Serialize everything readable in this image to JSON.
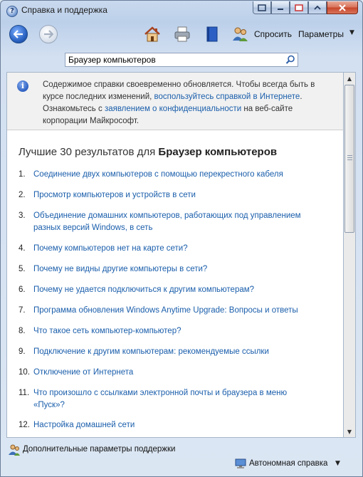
{
  "window": {
    "title": "Справка и поддержка",
    "accent": "#1a5eab"
  },
  "toolbar": {
    "back_icon": "back-arrow-icon",
    "forward_icon": "forward-arrow-icon",
    "home_icon": "home-icon",
    "print_icon": "printer-icon",
    "browse_icon": "book-icon",
    "ask_icon": "people-icon",
    "ask_label": "Спросить",
    "options_label": "Параметры"
  },
  "search": {
    "value": "Браузер компьютеров"
  },
  "info": {
    "text_1": "Содержимое справки своевременно обновляется. Чтобы всегда быть в курсе последних изменений, ",
    "link_1": "воспользуйтесь справкой в Интернете",
    "text_2": ". Ознакомьтесь с ",
    "link_2": "заявлением о конфиденциальности",
    "text_3": " на веб-сайте корпорации Майкрософт."
  },
  "results": {
    "heading_prefix": "Лучшие 30 результатов для ",
    "heading_query": "Браузер компьютеров",
    "items": [
      {
        "num": "1.",
        "label": "Соединение двух компьютеров с помощью перекрестного кабеля"
      },
      {
        "num": "2.",
        "label": "Просмотр компьютеров и устройств в сети"
      },
      {
        "num": "3.",
        "label": "Объединение домашних компьютеров, работающих под управлением разных версий Windows, в сеть"
      },
      {
        "num": "4.",
        "label": "Почему компьютеров нет на карте сети?"
      },
      {
        "num": "5.",
        "label": "Почему не видны другие компьютеры в сети?"
      },
      {
        "num": "6.",
        "label": "Почему не удается подключиться к другим компьютерам?"
      },
      {
        "num": "7.",
        "label": "Программа обновления Windows Anytime Upgrade: Вопросы и ответы"
      },
      {
        "num": "8.",
        "label": "Что такое сеть компьютер-компьютер?"
      },
      {
        "num": "9.",
        "label": "Подключение к другим компьютерам: рекомендуемые ссылки"
      },
      {
        "num": "10.",
        "label": "Отключение от Интернета"
      },
      {
        "num": "11.",
        "label": "Что произошло с ссылками электронной почты и браузера в меню «Пуск»?"
      },
      {
        "num": "12.",
        "label": "Настройка домашней сети"
      }
    ]
  },
  "bottom": {
    "support_label": "Дополнительные параметры поддержки",
    "status_label": "Автономная справка"
  }
}
